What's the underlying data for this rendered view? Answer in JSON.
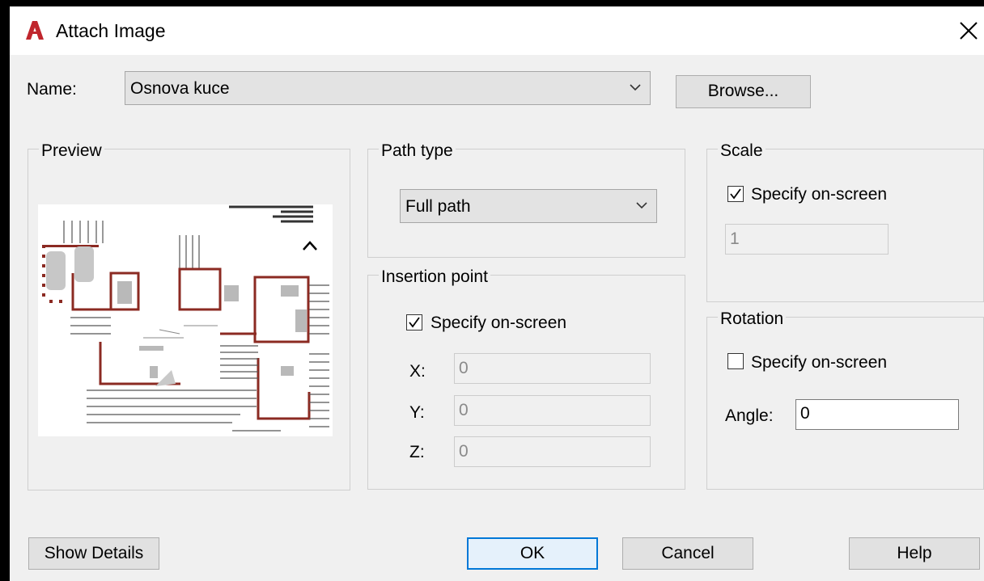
{
  "window": {
    "title": "Attach Image",
    "close_icon": "close-icon",
    "app_icon": "autocad-logo-icon",
    "brand_color": "#c0262d"
  },
  "name_row": {
    "label": "Name:",
    "value": "Osnova kuce",
    "browse_label": "Browse..."
  },
  "preview": {
    "title": "Preview"
  },
  "path_type": {
    "title": "Path type",
    "value": "Full path"
  },
  "insertion_point": {
    "title": "Insertion point",
    "specify_label": "Specify on-screen",
    "specify_checked": true,
    "x_label": "X:",
    "x_value": "0",
    "y_label": "Y:",
    "y_value": "0",
    "z_label": "Z:",
    "z_value": "0"
  },
  "scale": {
    "title": "Scale",
    "specify_label": "Specify on-screen",
    "specify_checked": true,
    "value": "1"
  },
  "rotation": {
    "title": "Rotation",
    "specify_label": "Specify on-screen",
    "specify_checked": false,
    "angle_label": "Angle:",
    "angle_value": "0"
  },
  "buttons": {
    "show_details": "Show Details",
    "ok": "OK",
    "cancel": "Cancel",
    "help": "Help"
  }
}
